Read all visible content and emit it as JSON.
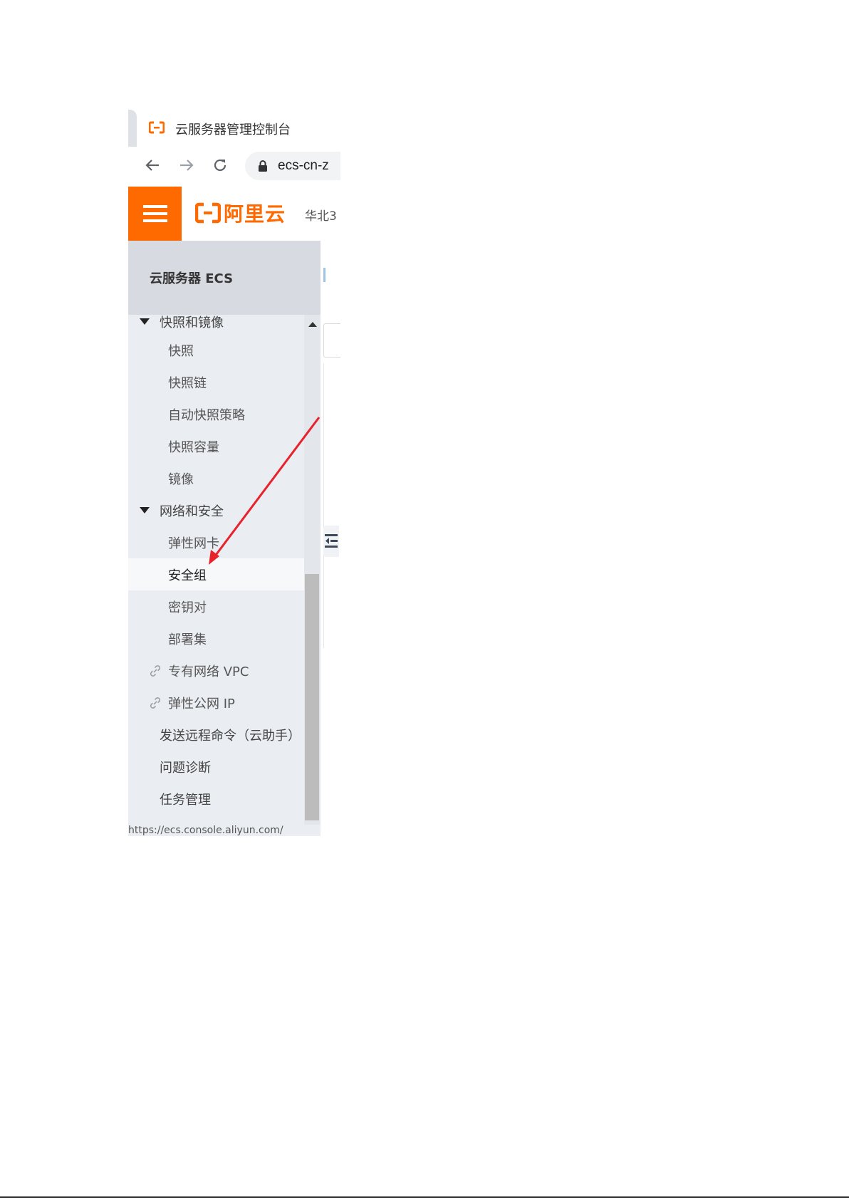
{
  "browser": {
    "tab_title": "云服务器管理控制台",
    "url": "ecs-cn-z"
  },
  "header": {
    "brand": "阿里云",
    "region": "华北3",
    "brand_color": "#ff6a00"
  },
  "sidebar": {
    "title": "云服务器 ECS",
    "items": [
      {
        "label": "快照和镜像",
        "type": "group",
        "expanded": true
      },
      {
        "label": "快照",
        "type": "item"
      },
      {
        "label": "快照链",
        "type": "item"
      },
      {
        "label": "自动快照策略",
        "type": "item"
      },
      {
        "label": "快照容量",
        "type": "item"
      },
      {
        "label": "镜像",
        "type": "item"
      },
      {
        "label": "网络和安全",
        "type": "group",
        "expanded": true
      },
      {
        "label": "弹性网卡",
        "type": "item"
      },
      {
        "label": "安全组",
        "type": "item",
        "active": true
      },
      {
        "label": "密钥对",
        "type": "item"
      },
      {
        "label": "部署集",
        "type": "item"
      },
      {
        "label": "专有网络 VPC",
        "type": "external",
        "icon": "link-icon"
      },
      {
        "label": "弹性公网 IP",
        "type": "external",
        "icon": "link-icon"
      },
      {
        "label": "发送远程命令（云助手）",
        "type": "top"
      },
      {
        "label": "问题诊断",
        "type": "top"
      },
      {
        "label": "任务管理",
        "type": "top"
      }
    ]
  },
  "annotation": {
    "color": "#e8212a",
    "icon": "arrow-pointer"
  },
  "status_bar": {
    "text": "https://ecs.console.aliyun.com/"
  }
}
